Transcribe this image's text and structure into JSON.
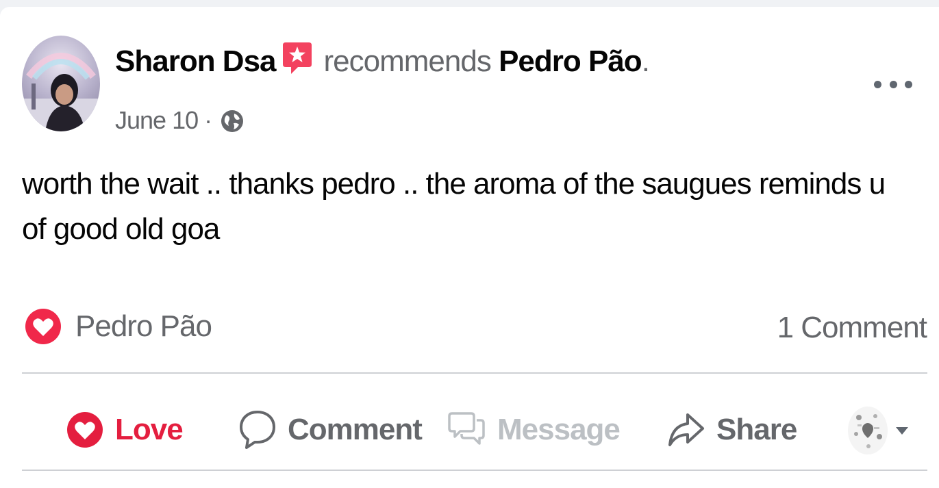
{
  "post": {
    "author": "Sharon Dsa",
    "verb": "recommends",
    "page": "Pedro Pão",
    "period": ".",
    "date": "June 10",
    "separator": " · ",
    "text": "worth the wait .. thanks pedro .. the aroma of the saugues reminds u of good old goa"
  },
  "reactions": {
    "reactor_name": "Pedro Pão",
    "comment_count": "1 Comment"
  },
  "actions": {
    "love_label": "Love",
    "comment_label": "Comment",
    "message_label": "Message",
    "share_label": "Share"
  },
  "colors": {
    "love": "#e41e3f",
    "recommend_badge": "#f3425f",
    "muted_text": "#65676b",
    "disabled_text": "#bcc0c4",
    "divider": "#ced0d4"
  },
  "icons": {
    "recommend": "recommend-star-icon",
    "audience": "globe-icon",
    "more": "more-horizontal-icon",
    "react": "heart-icon",
    "comment": "speech-bubble-icon",
    "message": "chat-bubbles-icon",
    "share": "share-arrow-icon",
    "dropdown": "caret-down-icon"
  }
}
